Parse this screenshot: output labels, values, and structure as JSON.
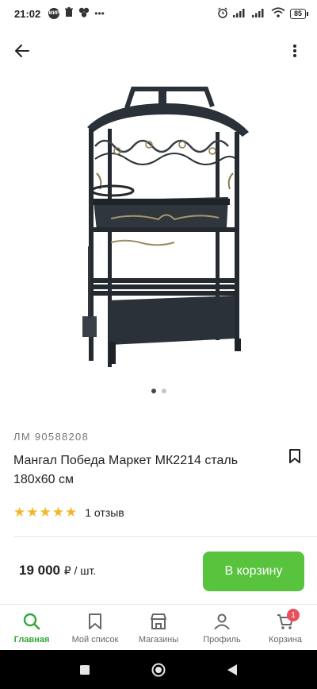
{
  "status_bar": {
    "time": "21:02",
    "badge_text": "МИР",
    "battery": "85"
  },
  "product": {
    "sku": "ЛМ 90588208",
    "title": "Мангал Победа Маркет МК2214 сталь 180х60 см",
    "rating": 5,
    "reviews": "1 отзыв",
    "price": "19 000",
    "price_unit": "₽ / шт.",
    "image_count": 2,
    "active_image": 1
  },
  "actions": {
    "add_to_cart": "В корзину"
  },
  "bottom_nav": {
    "items": [
      {
        "label": "Главная",
        "icon": "search-icon"
      },
      {
        "label": "Мой список",
        "icon": "bookmark-icon"
      },
      {
        "label": "Магазины",
        "icon": "store-icon"
      },
      {
        "label": "Профиль",
        "icon": "profile-icon"
      },
      {
        "label": "Корзина",
        "icon": "cart-icon",
        "badge": "1"
      }
    ],
    "active": 0
  },
  "colors": {
    "accent": "#58c33d",
    "nav_active": "#2ea836",
    "star": "#f3b72a",
    "badge": "#e8515a"
  }
}
